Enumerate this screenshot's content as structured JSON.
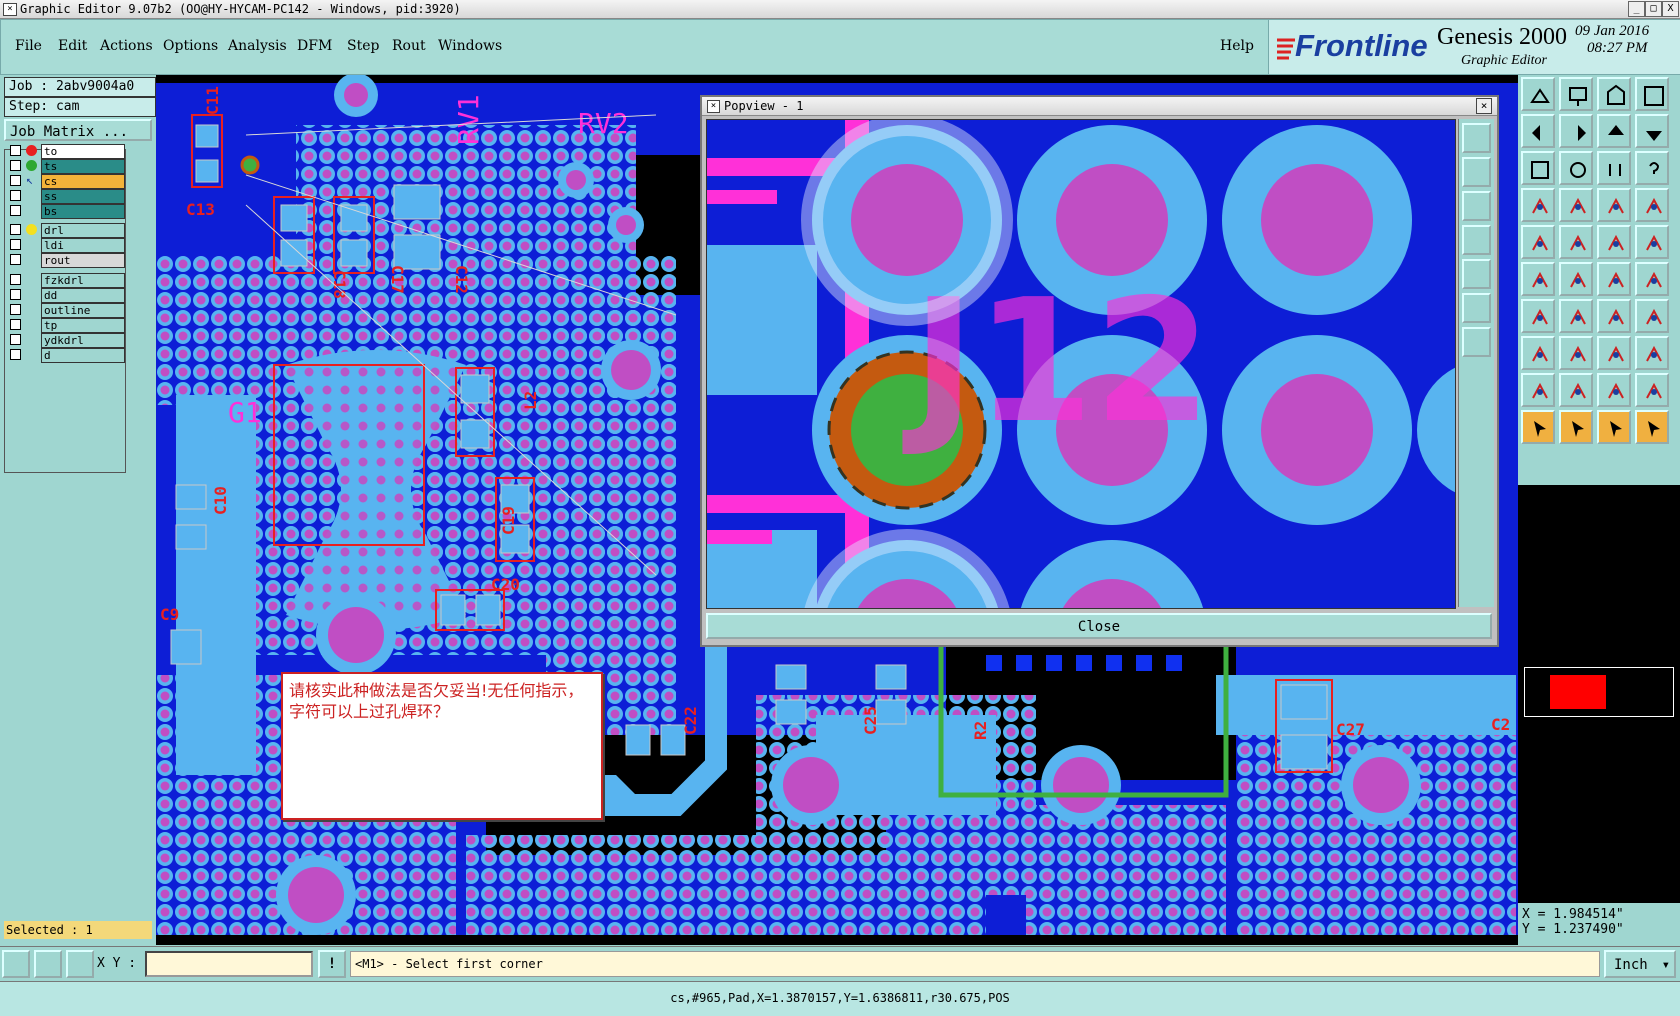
{
  "window": {
    "title": "Graphic Editor 9.07b2 (OO@HY-HYCAM-PC142 - Windows, pid:3920)",
    "minimize": "_",
    "maximize": "□",
    "close": "X"
  },
  "menu": [
    "File",
    "Edit",
    "Actions",
    "Options",
    "Analysis",
    "DFM",
    "Step",
    "Rout",
    "Windows"
  ],
  "help_label": "Help",
  "brand": {
    "logo": "Frontline",
    "product": "Genesis 2000",
    "subtitle": "Graphic Editor",
    "date": "09 Jan 2016",
    "time": "08:27 PM"
  },
  "job": {
    "job_label": "Job : 2abv9004a0",
    "step_label": "Step: cam",
    "matrix_button": "Job Matrix ..."
  },
  "layers": [
    {
      "name": "to",
      "dot": "#e82020",
      "bg": "#ffffff",
      "state": "display"
    },
    {
      "name": "ts",
      "dot": "#2ea830",
      "bg": "#2a8c88",
      "state": "display"
    },
    {
      "name": "cs",
      "dot": "arrow",
      "bg": "#f3b33a",
      "state": "work"
    },
    {
      "name": "ss",
      "dot": "",
      "bg": "#2a8c88",
      "state": "off"
    },
    {
      "name": "bs",
      "dot": "",
      "bg": "#2a8c88",
      "state": "off"
    },
    {
      "name": "drl",
      "dot": "#f3e020",
      "bg": "#9fd6d0",
      "state": "display"
    },
    {
      "name": "ldi",
      "dot": "",
      "bg": "#9fd6d0",
      "state": "off"
    },
    {
      "name": "rout",
      "dot": "",
      "bg": "#d8d8d8",
      "state": "off"
    },
    {
      "name": "fzkdrl",
      "dot": "",
      "bg": "#9fd6d0",
      "state": "off"
    },
    {
      "name": "dd",
      "dot": "",
      "bg": "#9fd6d0",
      "state": "off"
    },
    {
      "name": "outline",
      "dot": "",
      "bg": "#9fd6d0",
      "state": "off"
    },
    {
      "name": "tp",
      "dot": "",
      "bg": "#9fd6d0",
      "state": "off"
    },
    {
      "name": "ydkdrl",
      "dot": "",
      "bg": "#9fd6d0",
      "state": "off"
    },
    {
      "name": "d",
      "dot": "",
      "bg": "#9fd6d0",
      "state": "off"
    }
  ],
  "selected_label": "Selected : 1",
  "canvas_labels": [
    "C11",
    "RV1",
    "RV2",
    "C13",
    "C18",
    "C17",
    "C12",
    "L2",
    "G1",
    "C10",
    "C19",
    "C20",
    "C9",
    "C22",
    "C25",
    "R2",
    "C27",
    "C2"
  ],
  "note_text": "请核实此种做法是否欠妥当!无任何指示，字符可以上过孔焊环？",
  "popview": {
    "title": "Popview - 1",
    "close_button": "Close",
    "overlay_text": "J12"
  },
  "coords": {
    "x": "X = 1.984514\"",
    "y": "Y = 1.237490\""
  },
  "command": {
    "xy_label": "X Y :",
    "xy_value": "",
    "exclaim": "!",
    "prompt": "<M1> - Select first corner",
    "units": "Inch"
  },
  "status_text": "cs,#965,Pad,X=1.3870157,Y=1.6386811,r30.675,POS",
  "colors": {
    "board": "#0d1ed6",
    "copper": "#58b4f0",
    "drill": "#c04ec4",
    "silk": "#ff30d8",
    "selected_pad": "#3fb040",
    "highlight_ring": "#c45a10",
    "panel": "#9fd6d0"
  },
  "tool_icons": [
    "zoom-home",
    "zoom-in",
    "zoom-fit",
    "zoom-back",
    "pan-left",
    "pan-right",
    "pan-up",
    "pan-down",
    "zoom-window",
    "zoom-center",
    "one-to-one",
    "help",
    "measure",
    "grid",
    "snap",
    "layers-snap",
    "select-square",
    "select-poly",
    "ruler",
    "fill-circle",
    "net",
    "cross",
    "connect",
    "route",
    "line",
    "diagonal",
    "arc",
    "text",
    "split",
    "move",
    "flip",
    "group",
    "triangle-a",
    "triangle-b",
    "triangle-c",
    "triangle-d",
    "pointer",
    "pointer-selected",
    "pointer-box",
    "pointer-path"
  ]
}
